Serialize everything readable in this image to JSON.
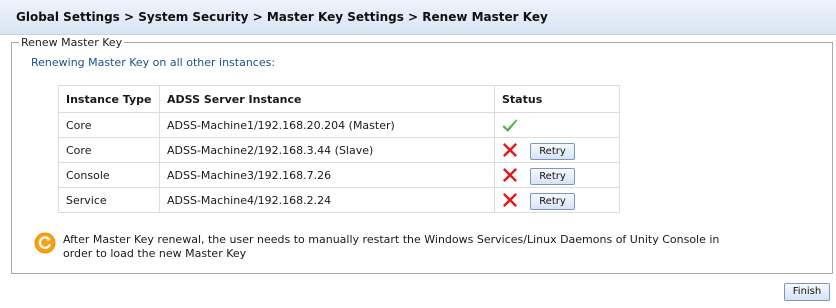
{
  "breadcrumb": "Global Settings > System Security > Master Key Settings > Renew Master Key",
  "section": {
    "legend": "Renew Master Key",
    "intro": "Renewing Master Key on all other instances:"
  },
  "table": {
    "headers": [
      "Instance Type",
      "ADSS Server Instance",
      "Status"
    ],
    "rows": [
      {
        "type": "Core",
        "instance": "ADSS-Machine1/192.168.20.204 (Master)",
        "status": "success",
        "retry_label": ""
      },
      {
        "type": "Core",
        "instance": "ADSS-Machine2/192.168.3.44 (Slave)",
        "status": "failed",
        "retry_label": "Retry"
      },
      {
        "type": "Console",
        "instance": "ADSS-Machine3/192.168.7.26",
        "status": "failed",
        "retry_label": "Retry"
      },
      {
        "type": "Service",
        "instance": "ADSS-Machine4/192.168.2.24",
        "status": "failed",
        "retry_label": "Retry"
      }
    ]
  },
  "note": {
    "icon": "restart-icon",
    "text": "After Master Key renewal, the user needs to manually restart the Windows Services/Linux Daemons of Unity Console in order to load the new Master Key"
  },
  "buttons": {
    "finish": "Finish"
  },
  "colors": {
    "success": "#3fa535",
    "failure": "#e01b1b",
    "note_icon": "#f29400",
    "header_bg": "#dde7f5"
  }
}
